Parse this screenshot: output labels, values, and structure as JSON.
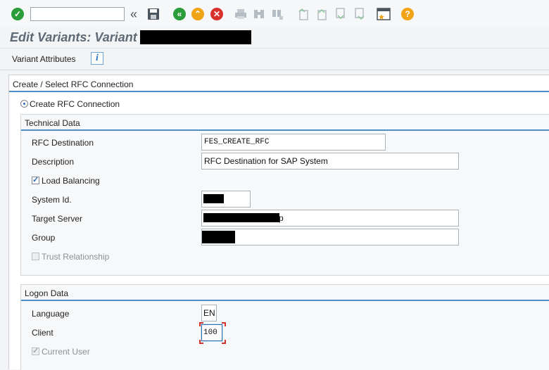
{
  "toolbar": {
    "command_placeholder": "",
    "icons": [
      "check-icon",
      "back-arrows-icon",
      "save-icon",
      "back-icon",
      "exit-icon",
      "cancel-icon",
      "print-icon",
      "find-icon",
      "find-next-icon",
      "first-page-icon",
      "prev-page-icon",
      "next-page-icon",
      "last-page-icon",
      "layout-icon",
      "help-icon"
    ]
  },
  "header": {
    "title": "Edit Variants: Variant"
  },
  "appbar": {
    "variant_attributes": "Variant Attributes",
    "info_glyph": "i"
  },
  "main": {
    "section_title": "Create / Select RFC Connection",
    "radio_create_label": "Create RFC Connection",
    "technical": {
      "title": "Technical Data",
      "rfc_destination_label": "RFC Destination",
      "rfc_destination_value": "FES_CREATE_RFC",
      "description_label": "Description",
      "description_value": "RFC Destination for SAP System",
      "load_balancing_label": "Load Balancing",
      "system_id_label": "System Id.",
      "target_server_label": "Target Server",
      "target_server_suffix": "p",
      "group_label": "Group",
      "trust_label": "Trust Relationship"
    },
    "logon": {
      "title": "Logon Data",
      "language_label": "Language",
      "language_value": "EN",
      "client_label": "Client",
      "client_value": "100",
      "current_user_label": "Current User"
    }
  },
  "glyphs": {
    "check": "✓",
    "cross": "✕",
    "back": "«",
    "up": "⌃",
    "question": "?",
    "tick": "✓"
  },
  "colors": {
    "accent": "#4b8fc6",
    "green": "#2a9d3a",
    "red": "#d9312b",
    "orange": "#f0a315"
  }
}
